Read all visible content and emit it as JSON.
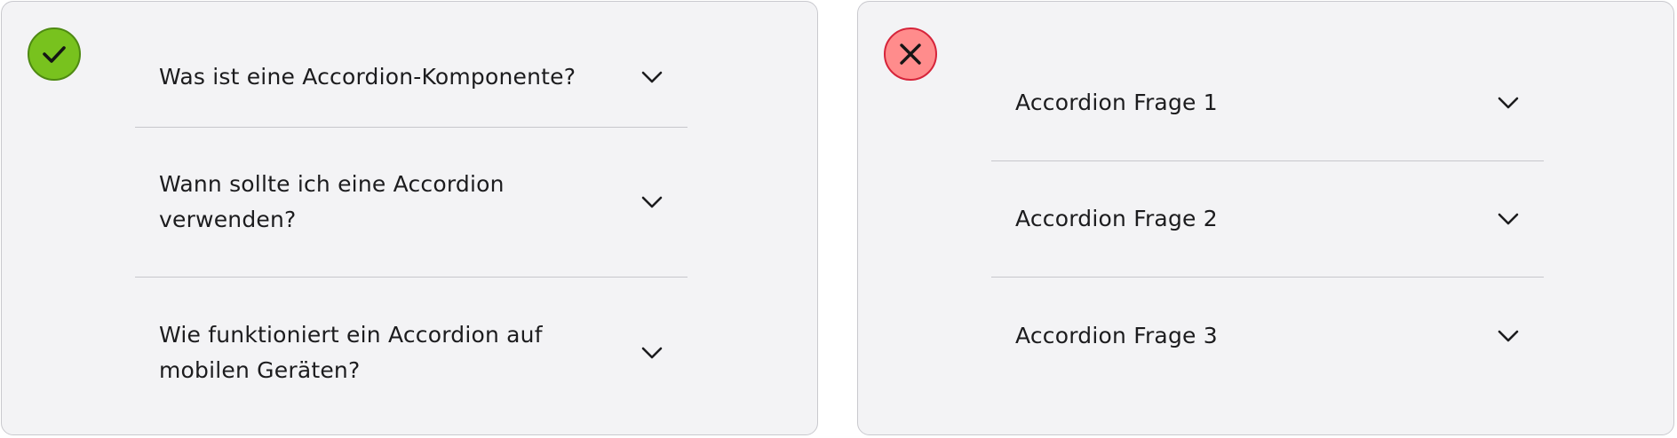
{
  "good_example": {
    "badge_icon": "check-icon",
    "badge_color": "#78c21e",
    "items": [
      {
        "question": "Was ist eine Accordion-Komponente?"
      },
      {
        "question": "Wann sollte ich eine Accordion verwenden?"
      },
      {
        "question": "Wie funktioniert ein Accordion auf mobilen Geräten?"
      }
    ]
  },
  "bad_example": {
    "badge_icon": "close-icon",
    "badge_color": "#ff8c8c",
    "items": [
      {
        "question": "Accordion Frage 1"
      },
      {
        "question": "Accordion Frage 2"
      },
      {
        "question": "Accordion Frage 3"
      }
    ]
  }
}
